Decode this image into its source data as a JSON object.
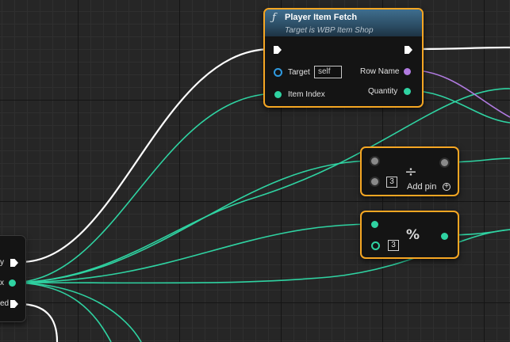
{
  "colors": {
    "exec": "#ffffff",
    "integer": "#2fd3a2",
    "name": "#b07ae0",
    "object": "#2f9ae0",
    "selected_border": "#f5a623",
    "header": "#3f6e8e"
  },
  "fetch_node": {
    "icon": "function-icon",
    "icon_glyph": "ƒ",
    "title": "Player Item Fetch",
    "subtitle": "Target is WBP Item Shop",
    "target_label": "Target",
    "target_value": "self",
    "item_index_label": "Item Index",
    "row_name_label": "Row Name",
    "quantity_label": "Quantity"
  },
  "divide_node": {
    "symbol": "÷",
    "input_b_value": "3",
    "add_pin_label": "Add pin",
    "add_pin_icon_glyph": "+"
  },
  "modulo_node": {
    "symbol": "%",
    "input_b_value": "3"
  },
  "left_node": {
    "pin1_label": "y",
    "pin2_label": "x",
    "pin3_label": "ed"
  }
}
